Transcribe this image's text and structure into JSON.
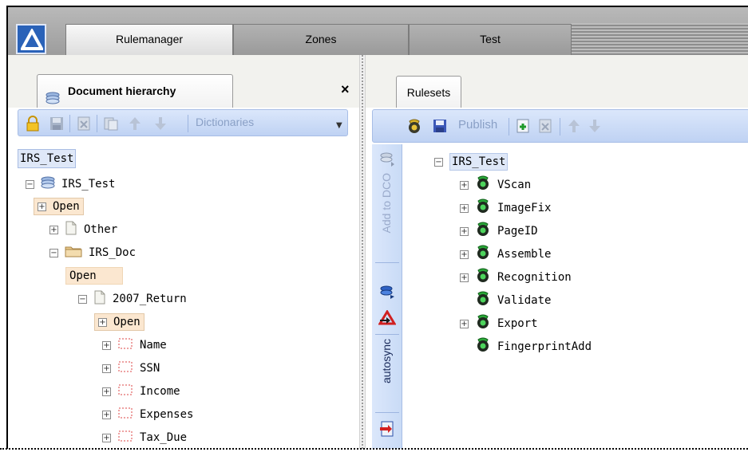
{
  "app": {
    "tabs": [
      "Rulemanager",
      "Zones",
      "Test"
    ],
    "active_tab": "Rulemanager"
  },
  "left_panel": {
    "tab_title": "Document hierarchy",
    "close_label": "×",
    "toolbar": {
      "dictionaries_label": "Dictionaries",
      "icons": [
        "lock-icon",
        "save-icon",
        "delete-icon",
        "copy-icon",
        "move-up-icon",
        "move-down-icon"
      ]
    },
    "selected_label": "IRS_Test",
    "tree": [
      {
        "label": "IRS_Test",
        "expander": "−",
        "icon": "stack-icon"
      },
      {
        "label": "Open",
        "expander": "+",
        "icon": ""
      },
      {
        "label": "Other",
        "expander": "+",
        "icon": "page-icon"
      },
      {
        "label": "IRS_Doc",
        "expander": "−",
        "icon": "folder-icon"
      },
      {
        "label": "Open",
        "expander": "",
        "icon": ""
      },
      {
        "label": "2007_Return",
        "expander": "−",
        "icon": "page-icon"
      },
      {
        "label": "Open",
        "expander": "+",
        "icon": ""
      },
      {
        "label": "Name",
        "expander": "+",
        "icon": "field-icon"
      },
      {
        "label": "SSN",
        "expander": "+",
        "icon": "field-icon"
      },
      {
        "label": "Income",
        "expander": "+",
        "icon": "field-icon"
      },
      {
        "label": "Expenses",
        "expander": "+",
        "icon": "field-icon"
      },
      {
        "label": "Tax_Due",
        "expander": "+",
        "icon": "field-icon"
      }
    ]
  },
  "right_panel": {
    "tab_title": "Rulesets",
    "toolbar": {
      "publish_label": "Publish",
      "icons": [
        "ruleset-icon",
        "save-icon",
        "add-icon",
        "delete-icon",
        "move-up-icon",
        "move-down-icon"
      ]
    },
    "side_strip": {
      "add_label": "Add to DCO",
      "autosync_label": "autosync"
    },
    "tree": [
      {
        "label": "IRS_Test",
        "expander": "−",
        "icon": ""
      },
      {
        "label": "VScan",
        "expander": "+",
        "icon": "ruleset-icon"
      },
      {
        "label": "ImageFix",
        "expander": "+",
        "icon": "ruleset-icon"
      },
      {
        "label": "PageID",
        "expander": "+",
        "icon": "ruleset-icon"
      },
      {
        "label": "Assemble",
        "expander": "+",
        "icon": "ruleset-icon"
      },
      {
        "label": "Recognition",
        "expander": "+",
        "icon": "ruleset-icon"
      },
      {
        "label": "Validate",
        "expander": "",
        "icon": "ruleset-icon"
      },
      {
        "label": "Export",
        "expander": "+",
        "icon": "ruleset-icon"
      },
      {
        "label": "FingerprintAdd",
        "expander": "",
        "icon": "ruleset-icon"
      }
    ]
  }
}
